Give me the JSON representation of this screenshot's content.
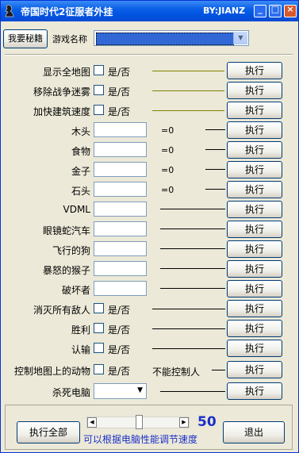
{
  "window": {
    "title": "帝国时代2征服者外挂",
    "author": "BY:JIANZ",
    "controls": {
      "minimize": "_",
      "maximize": "□",
      "close": "×"
    }
  },
  "header": {
    "secret_button": "我要秘籍",
    "game_label": "游戏名称"
  },
  "toggle_rows": [
    {
      "label": "显示全地图",
      "check_text": "是/否",
      "exec": "执行"
    },
    {
      "label": "移除战争迷雾",
      "check_text": "是/否",
      "exec": "执行"
    },
    {
      "label": "加快建筑速度",
      "check_text": "是/否",
      "exec": "执行"
    }
  ],
  "resource_rows": [
    {
      "label": "木头",
      "suffix": "=0",
      "exec": "执行"
    },
    {
      "label": "食物",
      "suffix": "=0",
      "exec": "执行"
    },
    {
      "label": "金子",
      "suffix": "=0",
      "exec": "执行"
    },
    {
      "label": "石头",
      "suffix": "=0",
      "exec": "执行"
    }
  ],
  "unit_rows": [
    {
      "label": "VDML",
      "exec": "执行"
    },
    {
      "label": "眼镜蛇汽车",
      "exec": "执行"
    },
    {
      "label": "飞行的狗",
      "exec": "执行"
    },
    {
      "label": "暴怒的猴子",
      "exec": "执行"
    },
    {
      "label": "破坏者",
      "exec": "执行"
    }
  ],
  "action_rows": [
    {
      "label": "消灭所有敌人",
      "check_text": "是/否",
      "exec": "执行"
    },
    {
      "label": "胜利",
      "check_text": "是/否",
      "exec": "执行"
    },
    {
      "label": "认输",
      "check_text": "是/否",
      "exec": "执行"
    },
    {
      "label": "控制地图上的动物",
      "check_text": "是/否",
      "note": "不能控制人",
      "exec": "执行"
    }
  ],
  "kill_row": {
    "label": "杀死电脑",
    "exec": "执行"
  },
  "footer": {
    "exec_all": "执行全部",
    "speed_value": "50",
    "speed_fraction": 0.5,
    "speed_note": "可以根据电脑性能调节速度",
    "exit": "退出"
  },
  "colors": {
    "titlebar": "#0a5fe6",
    "selection": "#3168d6",
    "accent_text": "#1a2fc8",
    "olive_line": "#808000"
  }
}
